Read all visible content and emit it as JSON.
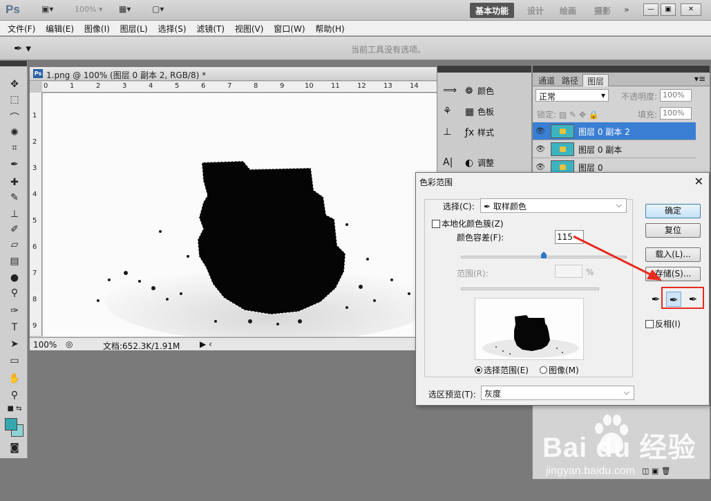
{
  "app": {
    "logo": "Ps",
    "zoom": "100%",
    "workspaces": [
      "基本功能",
      "设计",
      "绘画",
      "摄影"
    ],
    "more": "»"
  },
  "menu": [
    "文件(F)",
    "编辑(E)",
    "图像(I)",
    "图层(L)",
    "选择(S)",
    "滤镜(T)",
    "视图(V)",
    "窗口(W)",
    "帮助(H)"
  ],
  "options": {
    "hint": "当前工具没有选项。"
  },
  "document": {
    "badge": "Ps",
    "title": "1.png @ 100% (图层 0 副本 2, RGB/8) *",
    "ruler_top": [
      "0",
      "1",
      "2",
      "3",
      "4",
      "5",
      "6",
      "7",
      "8",
      "9",
      "10",
      "11",
      "12",
      "13",
      "14"
    ],
    "ruler_left": [
      "1",
      "2",
      "3",
      "4",
      "5",
      "6",
      "7",
      "8",
      "9"
    ],
    "status_zoom": "100%",
    "status_info": "文档:652.3K/1.91M"
  },
  "dock": {
    "items": [
      {
        "label": "颜色",
        "icon": "color-icon"
      },
      {
        "label": "色板",
        "icon": "swatches-icon"
      },
      {
        "label": "样式",
        "icon": "styles-icon"
      },
      {
        "label": "调整",
        "icon": "adjust-icon"
      }
    ]
  },
  "layers_panel": {
    "tabs": [
      "通道",
      "路径",
      "图层"
    ],
    "active_tab": "图层",
    "blend_mode": "正常",
    "opacity_label": "不透明度:",
    "opacity_value": "100%",
    "lock_label": "锁定:",
    "fill_label": "填充:",
    "fill_value": "100%",
    "layers": [
      {
        "name": "图层 0 副本 2",
        "selected": true
      },
      {
        "name": "图层 0 副本",
        "selected": false
      },
      {
        "name": "图层 0",
        "selected": false
      }
    ]
  },
  "dialog": {
    "title": "色彩范围",
    "select_label": "选择(C):",
    "select_value": "取样颜色",
    "localized_label": "本地化颜色簇(Z)",
    "tolerance_label": "颜色容差(F):",
    "tolerance_value": "115",
    "tolerance_level": 0.5,
    "range_label": "范围(R):",
    "range_unit": "%",
    "radio_selection": "选择范围(E)",
    "radio_image": "图像(M)",
    "preview_label": "选区预览(T):",
    "preview_value": "灰度",
    "buttons": {
      "ok": "确定",
      "reset": "复位",
      "load": "载入(L)...",
      "save": "存储(S)..."
    },
    "invert_label": "反相(I)"
  },
  "watermark": {
    "brand": "Bai du 经验",
    "url": "jingyan.baidu.com"
  },
  "colors": {
    "accent": "#3a7fd3",
    "foreground": "#37a7ae",
    "background": "#8fd4d4",
    "annotation": "#e82a1f"
  }
}
